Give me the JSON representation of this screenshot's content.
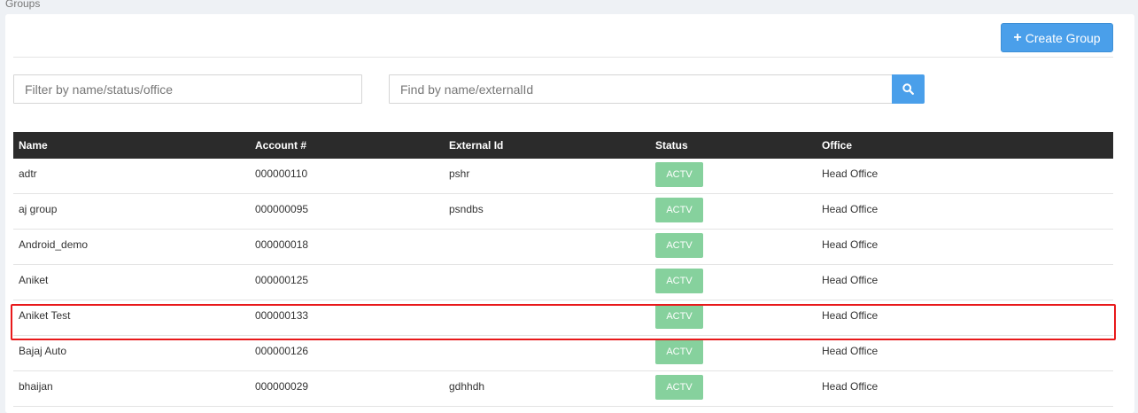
{
  "breadcrumb": "Groups",
  "toolbar": {
    "create_label": "Create Group",
    "create_icon": "plus-icon",
    "accent_color": "#4a9fea"
  },
  "filters": {
    "filter_placeholder": "Filter by name/status/office",
    "find_placeholder": "Find by name/externalId",
    "search_icon": "search-icon"
  },
  "table": {
    "headers": [
      "Name",
      "Account #",
      "External Id",
      "Status",
      "Office"
    ],
    "status_color": "#86d19d",
    "rows": [
      {
        "name": "adtr",
        "account": "000000110",
        "external_id": "pshr",
        "status": "ACTV",
        "office": "Head Office"
      },
      {
        "name": "aj group",
        "account": "000000095",
        "external_id": "psndbs",
        "status": "ACTV",
        "office": "Head Office"
      },
      {
        "name": "Android_demo",
        "account": "000000018",
        "external_id": "",
        "status": "ACTV",
        "office": "Head Office"
      },
      {
        "name": "Aniket",
        "account": "000000125",
        "external_id": "",
        "status": "ACTV",
        "office": "Head Office"
      },
      {
        "name": "Aniket Test",
        "account": "000000133",
        "external_id": "",
        "status": "ACTV",
        "office": "Head Office"
      },
      {
        "name": "Bajaj Auto",
        "account": "000000126",
        "external_id": "",
        "status": "ACTV",
        "office": "Head Office"
      },
      {
        "name": "bhaijan",
        "account": "000000029",
        "external_id": "gdhhdh",
        "status": "ACTV",
        "office": "Head Office"
      }
    ]
  },
  "highlight_color": "#e8191b"
}
